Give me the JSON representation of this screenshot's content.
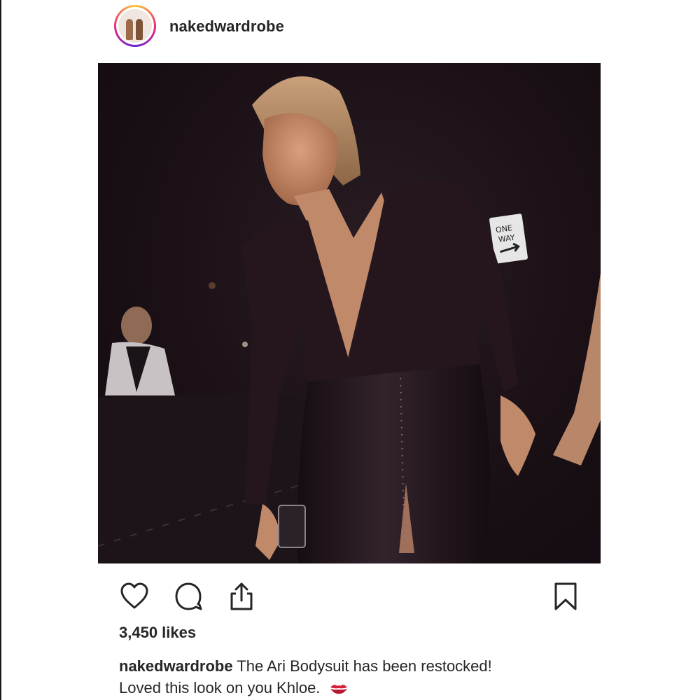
{
  "post": {
    "username": "nakedwardrobe",
    "likes": "3,450 likes",
    "caption": {
      "username": "nakedwardrobe",
      "line1": "The Ari Bodysuit has been restocked!",
      "line2": "Loved this look on you Khloe.",
      "emoji": "kiss-mark-icon"
    },
    "photo_sign": {
      "line1": "ONE",
      "line2": "WAY"
    }
  },
  "icons": {
    "like": "heart-icon",
    "comment": "comment-bubble-icon",
    "share": "share-upload-icon",
    "save": "bookmark-icon"
  },
  "colors": {
    "text": "#262626",
    "ring_gradient": [
      "#f9ce34",
      "#ee2a7b",
      "#6228d7"
    ],
    "kiss": "#d3213a"
  }
}
